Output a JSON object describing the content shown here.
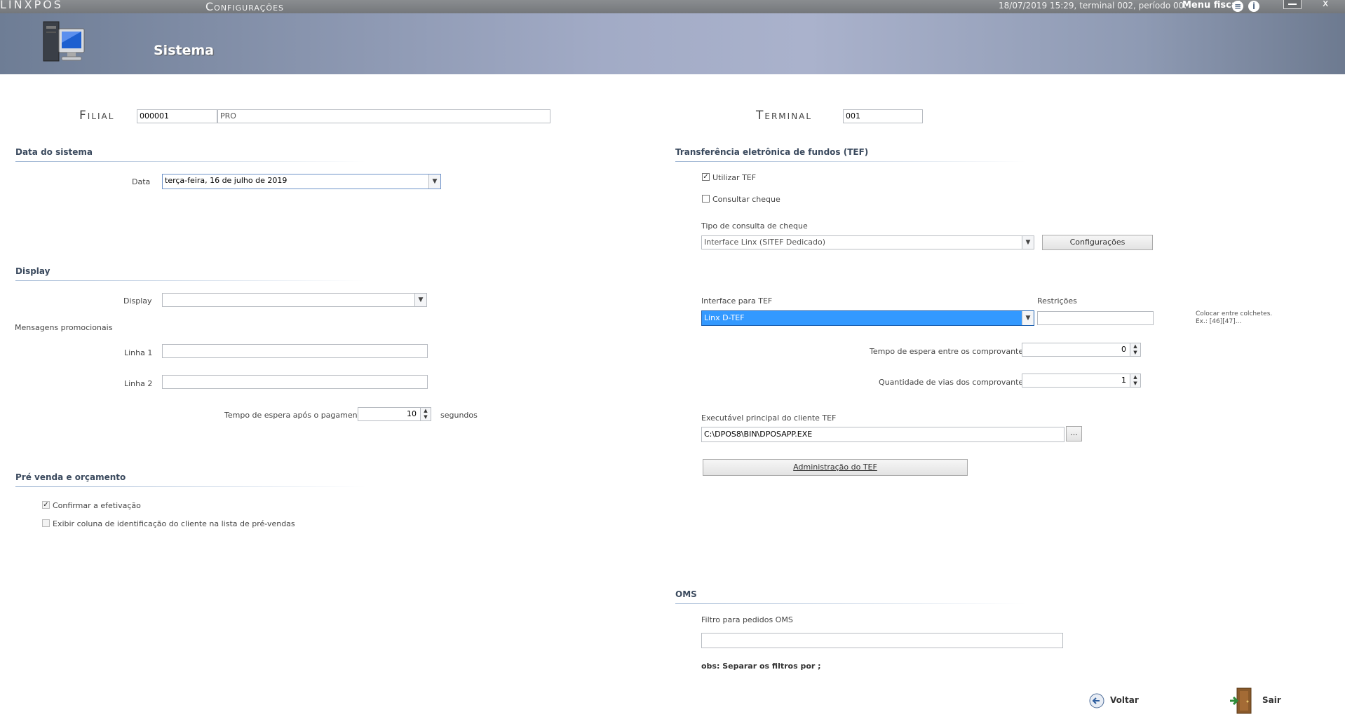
{
  "titlebar": {
    "app_name": "LINXPOS",
    "screen_title": "Configurações",
    "status": "18/07/2019 15:29, terminal 002, período 00.",
    "menu_label": "Menu fiscal",
    "close_glyph": "x"
  },
  "header": {
    "title": "Sistema"
  },
  "filial": {
    "label": "Filial",
    "code": "000001",
    "name": "PRO"
  },
  "terminal": {
    "label": "Terminal",
    "code": "001"
  },
  "data_sistema": {
    "section": "Data do sistema",
    "data_label": "Data",
    "data_value": "terça-feira, 16 de julho de 2019"
  },
  "display": {
    "section": "Display",
    "display_label": "Display",
    "display_value": "",
    "mensagens_label": "Mensagens promocionais",
    "linha1_label": "Linha 1",
    "linha1_value": "",
    "linha2_label": "Linha 2",
    "linha2_value": "",
    "tempo_label": "Tempo de espera após o pagamento",
    "tempo_value": "10",
    "tempo_unit": "segundos"
  },
  "pre_venda": {
    "section": "Pré venda e orçamento",
    "confirmar_label": "Confirmar a efetivação",
    "confirmar_checked": true,
    "exibir_label": "Exibir coluna de identificação do cliente na lista de pré-vendas",
    "exibir_checked": false
  },
  "tef": {
    "section": "Transferência eletrônica de fundos (TEF)",
    "utilizar_label": "Utilizar TEF",
    "utilizar_checked": true,
    "consultar_label": "Consultar cheque",
    "consultar_checked": false,
    "tipo_label": "Tipo de consulta de cheque",
    "tipo_value": "Interface Linx (SITEF Dedicado)",
    "config_button": "Configurações",
    "interface_label": "Interface para TEF",
    "interface_value": "Linx D-TEF",
    "restricoes_label": "Restrições",
    "restricoes_value": "",
    "hint_line1": "Colocar entre colchetes.",
    "hint_line2": "Ex.: [46][47]...",
    "espera_label": "Tempo de espera entre os comprovantes",
    "espera_value": "0",
    "vias_label": "Quantidade de vias dos comprovantes",
    "vias_value": "1",
    "exec_label": "Executável principal do cliente TEF",
    "exec_value": "C:\\DPOS8\\BIN\\DPOSAPP.EXE",
    "browse_label": "...",
    "admin_button": "Administração do TEF"
  },
  "oms": {
    "section": "OMS",
    "filtro_label": "Filtro para pedidos OMS",
    "filtro_value": "",
    "obs": "obs: Separar os filtros por ;"
  },
  "footer": {
    "voltar": "Voltar",
    "sair": "Sair"
  },
  "colors": {
    "selection": "#3399ff",
    "section_text": "#3b4a5e",
    "header_mid": "#aab2cc"
  },
  "icons": [
    "computer-icon",
    "menu-fiscal-icon",
    "info-icon",
    "minimize-icon",
    "back-arrow-icon",
    "exit-door-icon"
  ]
}
